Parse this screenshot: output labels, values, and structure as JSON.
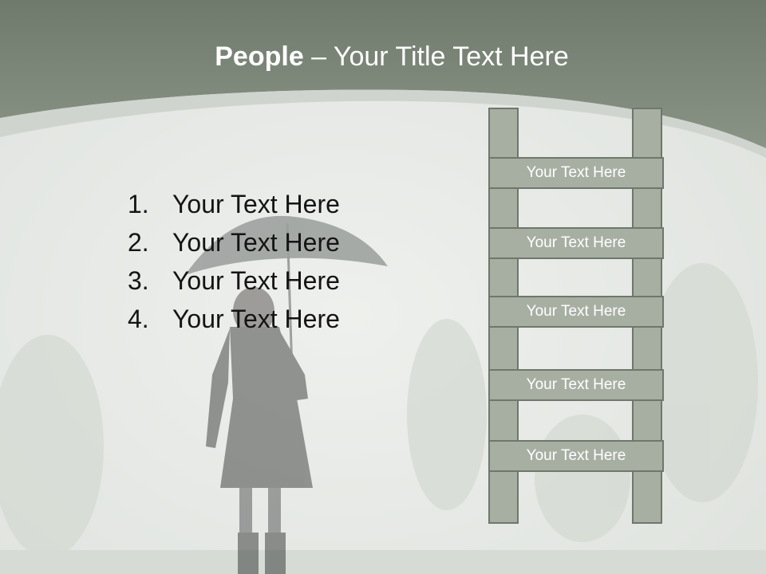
{
  "title": {
    "bold": "People",
    "separator": " – ",
    "rest": "Your Title Text Here"
  },
  "list_items": [
    {
      "number": "1.",
      "text": "Your Text Here"
    },
    {
      "number": "2.",
      "text": "Your Text Here"
    },
    {
      "number": "3.",
      "text": "Your Text Here"
    },
    {
      "number": "4.",
      "text": "Your Text Here"
    }
  ],
  "ladder_rungs": [
    "Your Text Here",
    "Your Text Here",
    "Your Text Here",
    "Your Text Here",
    "Your Text Here"
  ],
  "colors": {
    "header_band": "#7d887a",
    "slide_background": "#e3e6e2",
    "ladder_fill": "#a7afa3",
    "ladder_border": "#6f776c"
  }
}
